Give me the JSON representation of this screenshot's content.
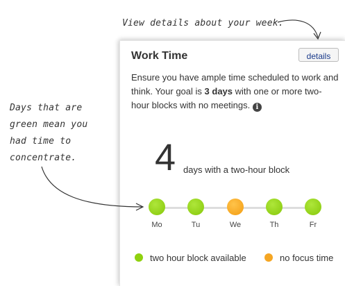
{
  "annotations": {
    "top": "View details about your week.",
    "left_lines": [
      "Days that are",
      "green mean you",
      "had time to",
      "concentrate."
    ]
  },
  "card": {
    "title": "Work Time",
    "details_button": "details",
    "description_pre": "Ensure you have ample time scheduled to work and think. Your goal is ",
    "description_goal": "3 days",
    "description_post": " with one or more two-hour blocks with no meetings.",
    "info_icon": "info-icon",
    "count": "4",
    "count_label": "days with a two-hour block",
    "days": [
      {
        "label": "Mo",
        "status": "green"
      },
      {
        "label": "Tu",
        "status": "green"
      },
      {
        "label": "We",
        "status": "orange"
      },
      {
        "label": "Th",
        "status": "green"
      },
      {
        "label": "Fr",
        "status": "green"
      }
    ],
    "legend": {
      "available": "two hour block available",
      "no_focus": "no focus time"
    }
  },
  "colors": {
    "green": "#8fd10f",
    "orange": "#f5a623",
    "button_text": "#1a3a8a"
  }
}
